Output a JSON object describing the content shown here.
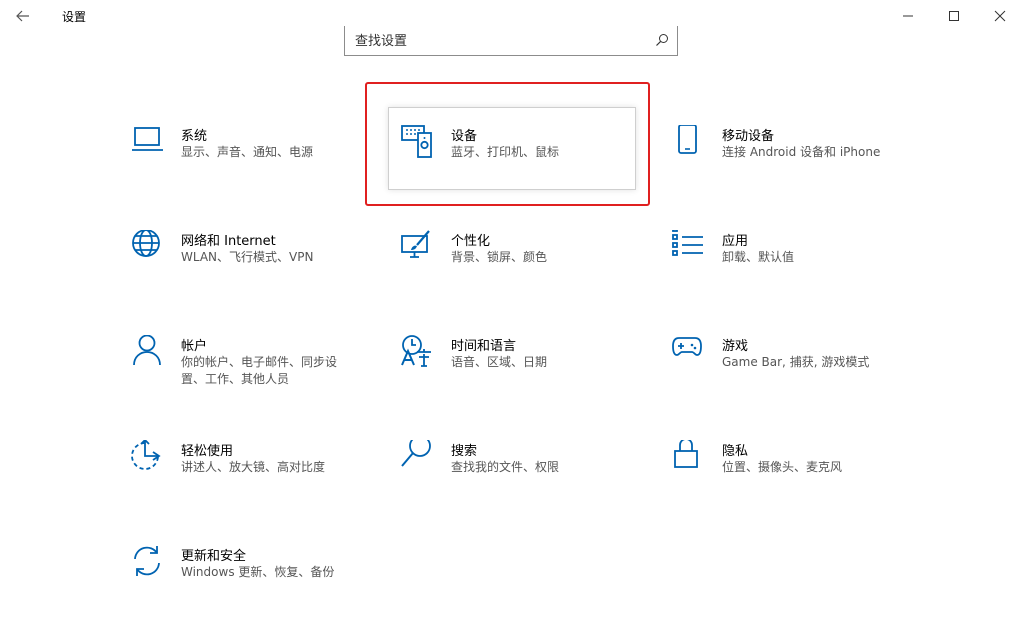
{
  "window": {
    "title": "设置"
  },
  "search": {
    "placeholder": "查找设置"
  },
  "colors": {
    "accent": "#0063b1",
    "highlight": "#e02020"
  },
  "tiles": [
    {
      "title": "系统",
      "desc": "显示、声音、通知、电源",
      "icon": "laptop-icon"
    },
    {
      "title": "设备",
      "desc": "蓝牙、打印机、鼠标",
      "icon": "devices-icon"
    },
    {
      "title": "移动设备",
      "desc": "连接 Android 设备和 iPhone",
      "icon": "phone-icon"
    },
    {
      "title": "网络和 Internet",
      "desc": "WLAN、飞行模式、VPN",
      "icon": "globe-icon"
    },
    {
      "title": "个性化",
      "desc": "背景、锁屏、颜色",
      "icon": "personalization-icon"
    },
    {
      "title": "应用",
      "desc": "卸载、默认值",
      "icon": "apps-list-icon"
    },
    {
      "title": "帐户",
      "desc": "你的帐户、电子邮件、同步设置、工作、其他人员",
      "icon": "person-icon"
    },
    {
      "title": "时间和语言",
      "desc": "语音、区域、日期",
      "icon": "time-language-icon"
    },
    {
      "title": "游戏",
      "desc": "Game Bar, 捕获, 游戏模式",
      "icon": "gamepad-icon"
    },
    {
      "title": "轻松使用",
      "desc": "讲述人、放大镜、高对比度",
      "icon": "ease-of-access-icon"
    },
    {
      "title": "搜索",
      "desc": "查找我的文件、权限",
      "icon": "search-icon"
    },
    {
      "title": "隐私",
      "desc": "位置、摄像头、麦克风",
      "icon": "lock-icon"
    },
    {
      "title": "更新和安全",
      "desc": "Windows 更新、恢复、备份",
      "icon": "sync-icon"
    }
  ]
}
